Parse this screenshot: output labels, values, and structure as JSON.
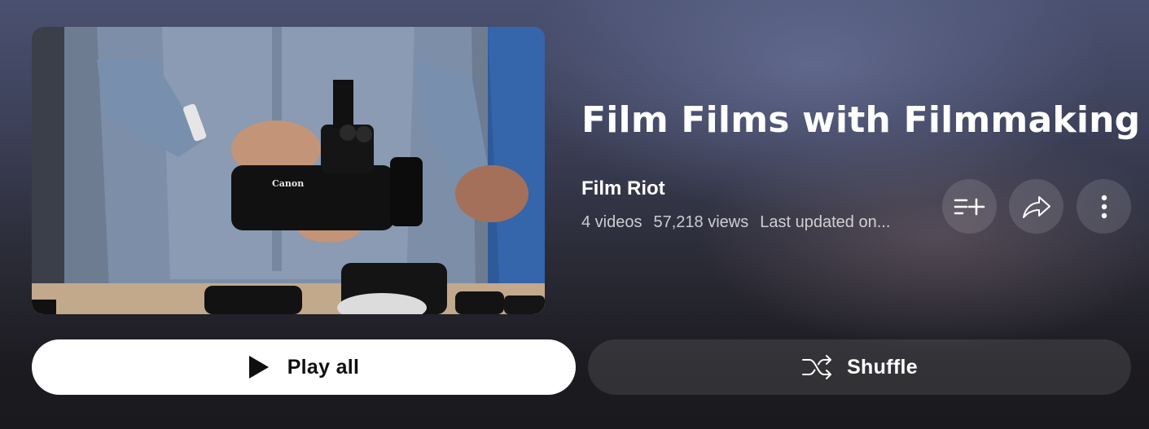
{
  "playlist": {
    "title": "Film Films with Filmmaking",
    "channel": "Film Riot",
    "video_count": "4 videos",
    "views": "57,218 views",
    "updated": "Last updated on..."
  },
  "thumbnail": {
    "brand_text": "Canon"
  },
  "actions": {
    "save_icon": "playlist-add-icon",
    "share_icon": "share-icon",
    "more_icon": "more-vertical-icon"
  },
  "buttons": {
    "play_all": "Play all",
    "shuffle": "Shuffle"
  }
}
